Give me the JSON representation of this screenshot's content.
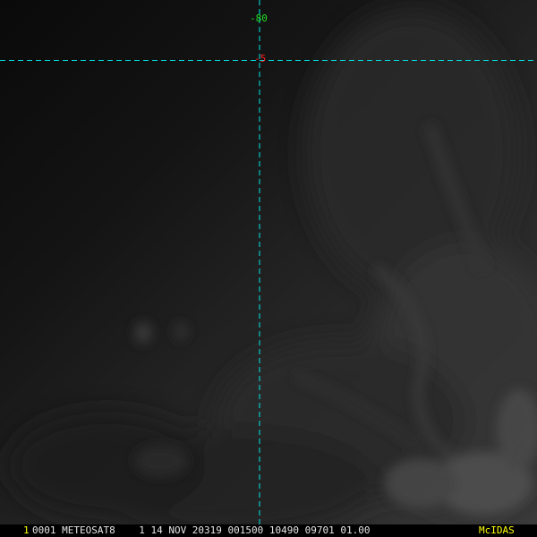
{
  "grid_labels": {
    "longitude": "-80",
    "latitude": "-5"
  },
  "status_bar": {
    "frame_number": "1",
    "status_line": "0001 METEOSAT8    1 14 NOV 20319 001500 10490 09701 01.00",
    "brand": "McIDAS"
  },
  "colors": {
    "grid_line": "#00e5e5",
    "longitude_label": "#22dd22",
    "latitude_label": "#ff2020",
    "status_text": "#e6e6e6",
    "frame_number": "#ffff00",
    "brand": "#ffff00",
    "background": "#000000"
  }
}
